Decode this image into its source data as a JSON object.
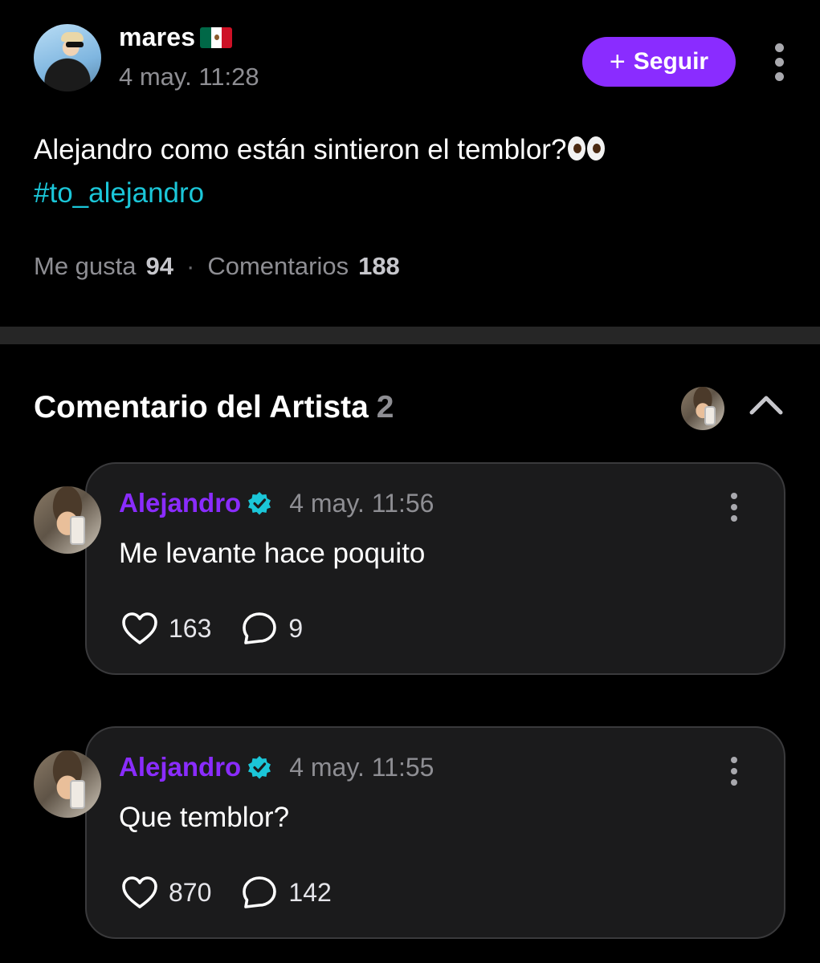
{
  "post": {
    "author": "mares",
    "author_flag": "mexico-flag",
    "time": "4 may. 11:28",
    "follow_label": "Seguir",
    "text": "Alejandro como están sintieron el temblor?",
    "text_emoji": "eyes-emoji",
    "hashtag": "#to_alejandro",
    "likes_label": "Me gusta",
    "likes_count": "94",
    "separator": "·",
    "comments_label": "Comentarios",
    "comments_count": "188"
  },
  "artist_section": {
    "title": "Comentario del Artista",
    "count": "2"
  },
  "comments": [
    {
      "name": "Alejandro",
      "time": "4 may. 11:56",
      "text": "Me levante hace poquito",
      "likes": "163",
      "replies": "9"
    },
    {
      "name": "Alejandro",
      "time": "4 may. 11:55",
      "text": "Que temblor?",
      "likes": "870",
      "replies": "142"
    }
  ],
  "colors": {
    "accent": "#8a2cff",
    "hashtag": "#1bc6d8",
    "verified": "#1bc6d8",
    "muted": "#8e8e93",
    "card": "#1b1b1c"
  }
}
